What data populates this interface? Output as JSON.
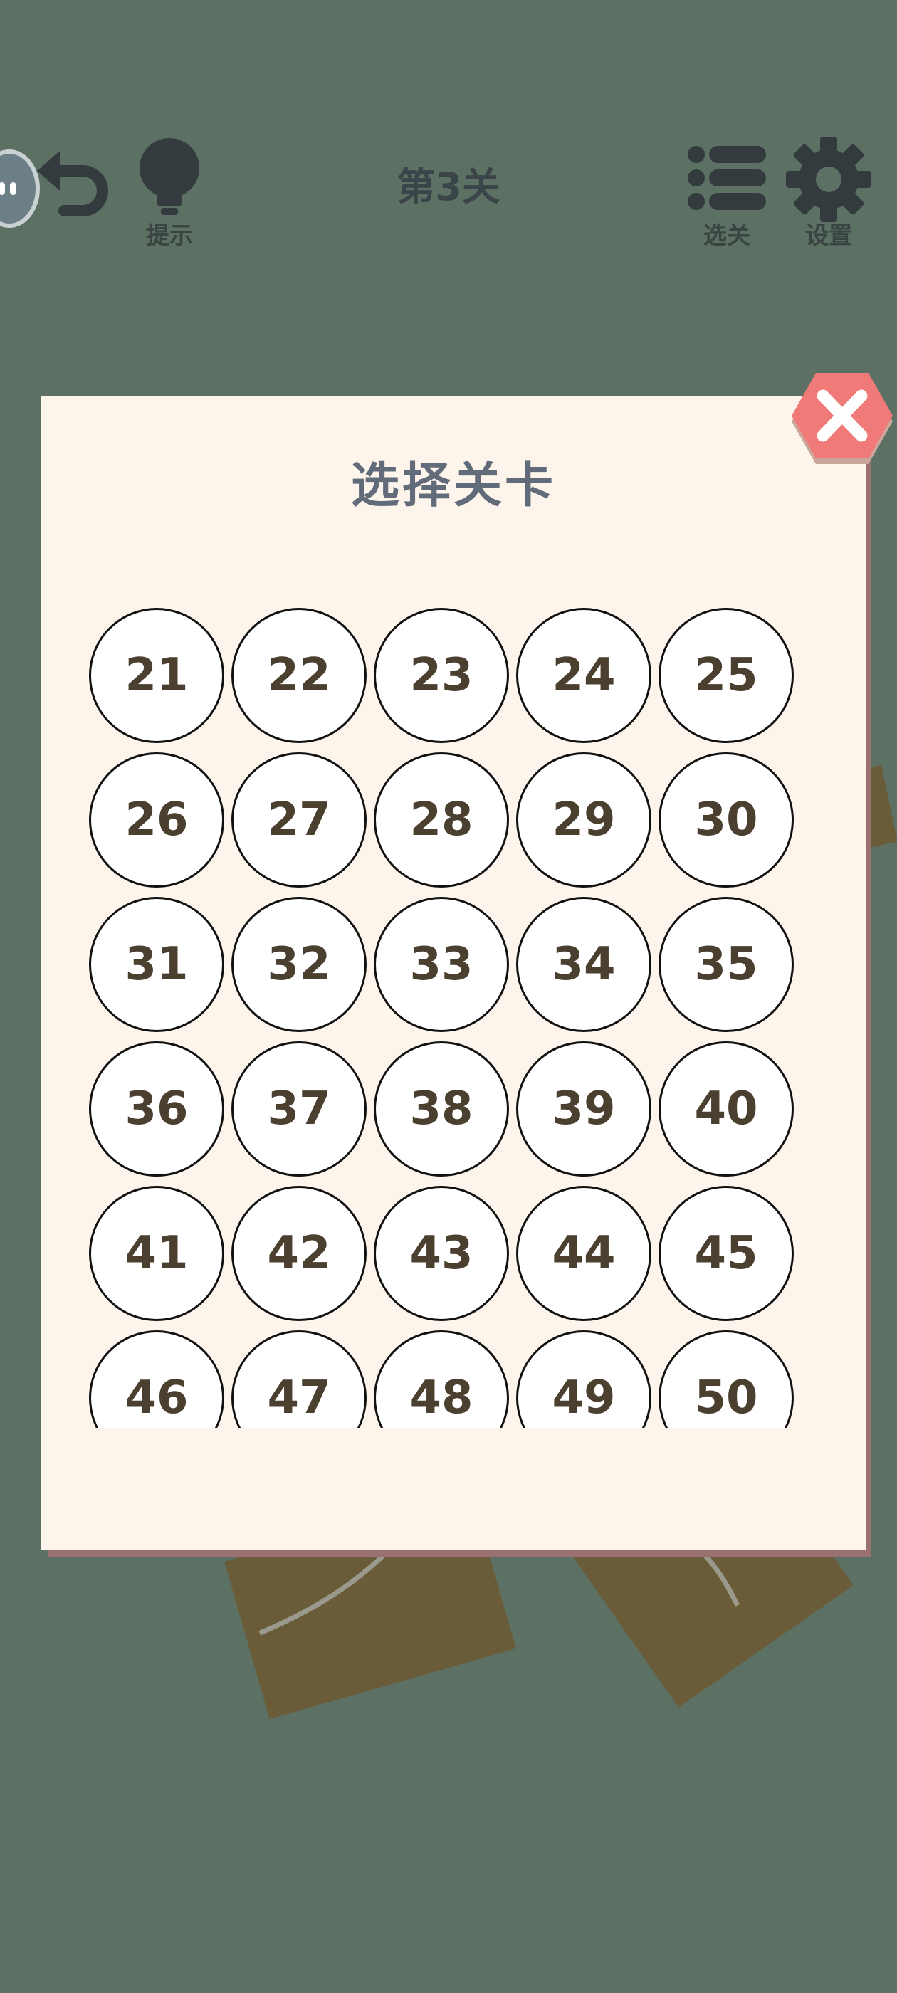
{
  "header": {
    "hint_label": "提示",
    "level_title": "第3关",
    "select_level_label": "选关",
    "settings_label": "设置"
  },
  "dialog": {
    "title": "选择关卡",
    "levels": [
      "21",
      "22",
      "23",
      "24",
      "25",
      "26",
      "27",
      "28",
      "29",
      "30",
      "31",
      "32",
      "33",
      "34",
      "35",
      "36",
      "37",
      "38",
      "39",
      "40",
      "41",
      "42",
      "43",
      "44",
      "45",
      "46",
      "47",
      "48",
      "49",
      "50"
    ]
  },
  "colors": {
    "background": "#5c7063",
    "dialog_background": "#fdf4ec",
    "dialog_title": "#616b79",
    "level_number": "#4b4030",
    "close_button": "#ef7a78",
    "board_piece": "#6a5c38",
    "icon_dark": "#333b3f"
  }
}
